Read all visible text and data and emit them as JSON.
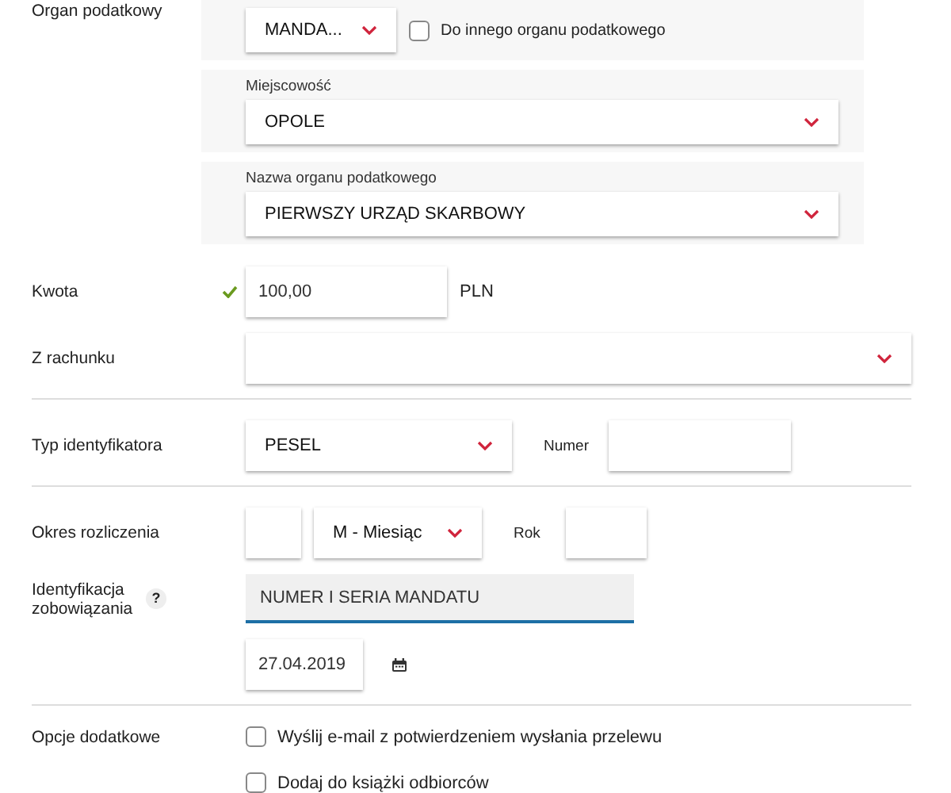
{
  "tax_office": {
    "label": "Organ podatkowy",
    "form_type": "MANDA...",
    "other_office": {
      "label": "Do innego organu podatkowego",
      "checked": false
    },
    "city": {
      "label": "Miejscowość",
      "value": "OPOLE"
    },
    "office_name": {
      "label": "Nazwa organu podatkowego",
      "value": "PIERWSZY URZĄD SKARBOWY"
    }
  },
  "amount": {
    "label": "Kwota",
    "valid": true,
    "value": "100,00",
    "currency": "PLN"
  },
  "account": {
    "label": "Z rachunku"
  },
  "identifier": {
    "label": "Typ identyfikatora",
    "type": "PESEL",
    "number_label": "Numer"
  },
  "period": {
    "label": "Okres rozliczenia",
    "unit": "M - Miesiąc",
    "year_label": "Rok"
  },
  "obligation": {
    "label": "Identyfikacja zobowiązania",
    "help": "?",
    "placeholder": "NUMER I SERIA MANDATU",
    "focused": true,
    "date": "27.04.2019"
  },
  "options": {
    "label": "Opcje dodatkowe",
    "items": [
      {
        "label": "Wyślij e-mail z potwierdzeniem wysłania przelewu",
        "checked": false
      },
      {
        "label": "Dodaj do książki odbiorców",
        "checked": false
      }
    ]
  }
}
